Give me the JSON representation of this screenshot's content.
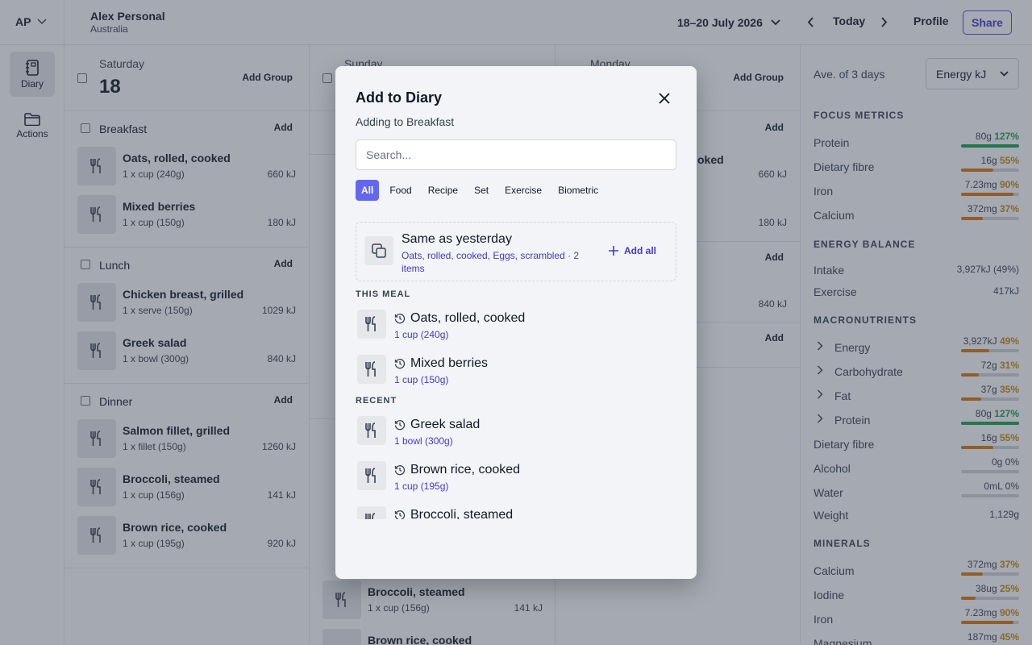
{
  "topbar": {
    "account": "AP",
    "user_name": "Alex Personal",
    "user_sub": "Australia",
    "date_range": "18–20 July 2026",
    "today": "Today",
    "profile": "Profile",
    "share": "Share"
  },
  "sidenav": {
    "diary": "Diary",
    "actions": "Actions"
  },
  "days": [
    {
      "dow": "Saturday",
      "num": "18",
      "add_group": "Add Group",
      "meals": [
        {
          "name": "Breakfast",
          "add": "Add",
          "items": [
            {
              "name": "Oats, rolled, cooked",
              "sub": "1 x cup (240g)",
              "kj": "660 kJ"
            },
            {
              "name": "Mixed berries",
              "sub": "1 x cup (150g)",
              "kj": "180 kJ"
            }
          ]
        },
        {
          "name": "Lunch",
          "add": "Add",
          "items": [
            {
              "name": "Chicken breast, grilled",
              "sub": "1 x serve (150g)",
              "kj": "1029 kJ"
            },
            {
              "name": "Greek salad",
              "sub": "1 x bowl (300g)",
              "kj": "840 kJ"
            }
          ]
        },
        {
          "name": "Dinner",
          "add": "Add",
          "items": [
            {
              "name": "Salmon fillet, grilled",
              "sub": "1 x fillet (150g)",
              "kj": "1260 kJ"
            },
            {
              "name": "Broccoli, steamed",
              "sub": "1 x cup (156g)",
              "kj": "141 kJ"
            },
            {
              "name": "Brown rice, cooked",
              "sub": "1 x cup (195g)",
              "kj": "920 kJ"
            }
          ]
        }
      ]
    },
    {
      "dow": "Sunday",
      "partial": {
        "name1": "Broccoli, steamed",
        "sub1": "1 x cup (156g)",
        "kj1": "141 kJ",
        "name2": "Brown rice, cooked"
      }
    },
    {
      "dow": "Monday",
      "add_group": "Add Group",
      "add": "Add",
      "frag_oked": "oked",
      "kj_660": "660 kJ",
      "kj_180": "180 kJ",
      "kj_840": "840 kJ"
    }
  ],
  "summary": {
    "avg_label": "Ave. of 3 days",
    "select_value": "Energy kJ",
    "sections": {
      "focus": "FOCUS METRICS",
      "energy": "ENERGY BALANCE",
      "macro": "MACRONUTRIENTS",
      "minerals": "MINERALS"
    },
    "focus": [
      {
        "label": "Protein",
        "value": "80g",
        "pct": "127%",
        "fill": 1.0,
        "color": "#16a34a"
      },
      {
        "label": "Dietary fibre",
        "value": "16g",
        "pct": "55%",
        "fill": 0.55,
        "color": "#d97706"
      },
      {
        "label": "Iron",
        "value": "7.23mg",
        "pct": "90%",
        "fill": 0.9,
        "color": "#d97706"
      },
      {
        "label": "Calcium",
        "value": "372mg",
        "pct": "37%",
        "fill": 0.37,
        "color": "#d97706"
      }
    ],
    "energy_balance": [
      {
        "label": "Intake",
        "value": "3,927kJ (49%)"
      },
      {
        "label": "Exercise",
        "value": "417kJ"
      }
    ],
    "macros": [
      {
        "label": "Energy",
        "value": "3,927kJ",
        "pct": "49%",
        "fill": 0.49,
        "color": "#d97706",
        "chev": true
      },
      {
        "label": "Carbohydrate",
        "value": "72g",
        "pct": "31%",
        "fill": 0.31,
        "color": "#d97706",
        "chev": true
      },
      {
        "label": "Fat",
        "value": "37g",
        "pct": "35%",
        "fill": 0.35,
        "color": "#d97706",
        "chev": true
      },
      {
        "label": "Protein",
        "value": "80g",
        "pct": "127%",
        "fill": 1.0,
        "color": "#16a34a",
        "chev": true
      },
      {
        "label": "Dietary fibre",
        "value": "16g",
        "pct": "55%",
        "fill": 0.55,
        "color": "#d97706"
      },
      {
        "label": "Alcohol",
        "value": "0g",
        "pct": "0%",
        "fill": 0,
        "color": "#d97706"
      },
      {
        "label": "Water",
        "value": "0mL",
        "pct": "0%",
        "fill": 0,
        "color": "#d97706"
      },
      {
        "label": "Weight",
        "value": "1,129g"
      }
    ],
    "minerals": [
      {
        "label": "Calcium",
        "value": "372mg",
        "pct": "37%",
        "fill": 0.37,
        "color": "#d97706"
      },
      {
        "label": "Iodine",
        "value": "38ug",
        "pct": "25%",
        "fill": 0.25,
        "color": "#d97706"
      },
      {
        "label": "Iron",
        "value": "7.23mg",
        "pct": "90%",
        "fill": 0.9,
        "color": "#d97706"
      },
      {
        "label": "Magnesium",
        "value": "187mg",
        "pct": "45%",
        "fill": 0.45,
        "color": "#d97706"
      }
    ]
  },
  "modal": {
    "title": "Add to Diary",
    "subtitle": "Adding to Breakfast",
    "search_placeholder": "Search...",
    "tabs": [
      "All",
      "Food",
      "Recipe",
      "Set",
      "Exercise",
      "Biometric"
    ],
    "same": {
      "title": "Same as yesterday",
      "desc": "Oats, rolled, cooked, Eggs, scrambled · 2 items",
      "add_all": "Add all"
    },
    "this_meal_label": "THIS MEAL",
    "this_meal": [
      {
        "name": "Oats, rolled, cooked",
        "sub": "1 cup (240g)"
      },
      {
        "name": "Mixed berries",
        "sub": "1 cup (150g)"
      }
    ],
    "recent_label": "RECENT",
    "recent": [
      {
        "name": "Greek salad",
        "sub": "1 bowl (300g)"
      },
      {
        "name": "Brown rice, cooked",
        "sub": "1 cup (195g)"
      },
      {
        "name": "Broccoli, steamed",
        "sub": ""
      }
    ]
  },
  "colors": {
    "accent": "#6366f1",
    "link": "#4338ca",
    "good": "#16a34a",
    "warn": "#d97706"
  }
}
